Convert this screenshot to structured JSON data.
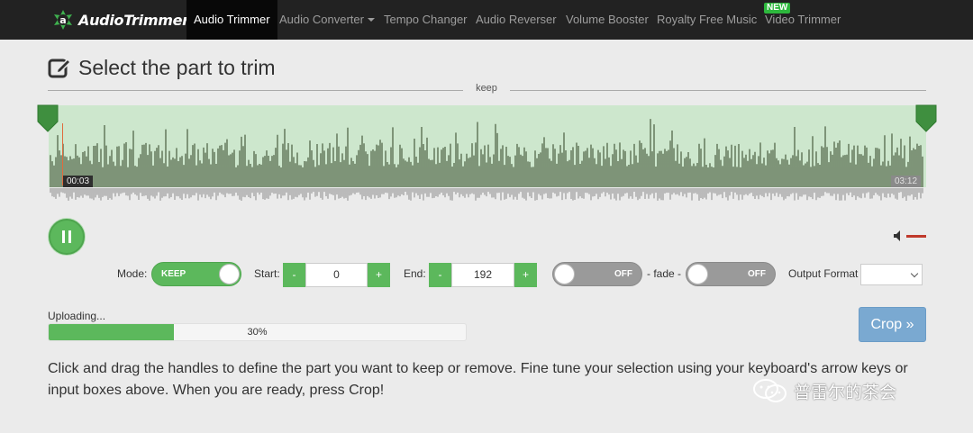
{
  "brand": {
    "name": "AudioTrimmer",
    "mark": "a"
  },
  "nav": {
    "items": [
      {
        "label": "Audio Trimmer"
      },
      {
        "label": "Audio Converter"
      },
      {
        "label": "Tempo Changer"
      },
      {
        "label": "Audio Reverser"
      },
      {
        "label": "Volume Booster"
      },
      {
        "label": "Royalty Free Music"
      },
      {
        "label": "Video Trimmer"
      }
    ],
    "badge": "NEW"
  },
  "page": {
    "title": "Select the part to trim",
    "mode_label": "keep"
  },
  "waveform": {
    "start_time": "00:03",
    "end_time": "03:12"
  },
  "controls": {
    "mode_label": "Mode:",
    "mode_value": "KEEP",
    "start_label": "Start:",
    "start_value": "0",
    "end_label": "End:",
    "end_value": "192",
    "minus": "-",
    "plus": "+",
    "fade_in_state": "OFF",
    "fade_label": "- fade -",
    "fade_out_state": "OFF",
    "output_label": "Output Format",
    "output_value": ""
  },
  "upload": {
    "label": "Uploading...",
    "percent_text": "30%",
    "progress": 0.3
  },
  "crop_button": "Crop »",
  "instructions": "Click and drag the handles to define the part you want to keep or remove. Fine tune your selection using your keyboard's arrow keys or input boxes above. When you are ready, press Crop!",
  "watermark": "普雷尔的茶会",
  "colors": {
    "accent_green": "#5cb85c",
    "crop_blue": "#7aa9d1",
    "nav_bg": "#222222",
    "selection": "#cde7cd",
    "wave_dark": "#4a5e40"
  }
}
